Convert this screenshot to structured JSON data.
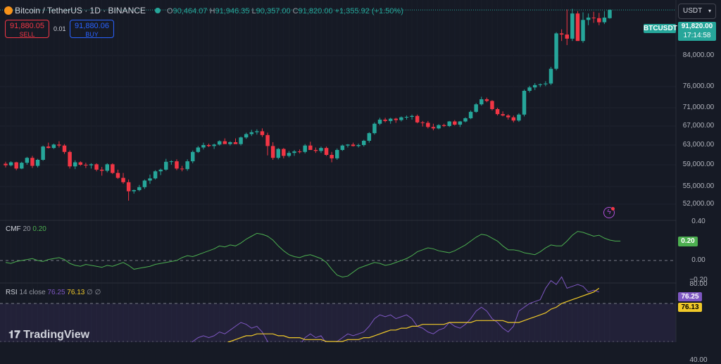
{
  "header": {
    "symbol": "Bitcoin / TetherUS · 1D · BINANCE",
    "o_label": "O",
    "o": "90,464.07",
    "h_label": "H",
    "h": "91,946.35",
    "l_label": "L",
    "l": "90,357.00",
    "c_label": "C",
    "c": "91,820.00",
    "change": "+1,355.92 (+1.50%)"
  },
  "trade": {
    "sell_price": "91,880.05",
    "sell_label": "SELL",
    "spread": "0.01",
    "buy_price": "91,880.06",
    "buy_label": "BUY"
  },
  "currency_select": "USDT",
  "price_badge": {
    "ticker": "BTCUSDT",
    "price": "91,820.00",
    "countdown": "17:14:58"
  },
  "cmf": {
    "label": "CMF",
    "period": "20",
    "value": "0.20",
    "badge": "0.20"
  },
  "rsi": {
    "label": "RSI",
    "params": "14 close",
    "value": "76.25",
    "ma": "76.13",
    "extra": "∅ ∅",
    "badge_rsi": "76.25",
    "badge_ma": "76.13"
  },
  "brand": "TradingView",
  "colors": {
    "up": "#26a69a",
    "down": "#f23645",
    "rsi": "#7e57c2",
    "rsi_ma": "#f0c929",
    "cmf": "#4caf50"
  },
  "chart_data": {
    "type": "candlestick",
    "y_ticks": [
      84000,
      76000,
      71000,
      67000,
      63000,
      59000,
      55000,
      52000
    ],
    "y_tick_labels": [
      "84,000.00",
      "76,000.00",
      "71,000.00",
      "67,000.00",
      "63,000.00",
      "59,000.00",
      "55,000.00",
      "52,000.00"
    ],
    "candles": [
      [
        59200,
        59600,
        58500,
        58900
      ],
      [
        58900,
        59700,
        58700,
        59500
      ],
      [
        59500,
        59600,
        58000,
        58300
      ],
      [
        58300,
        59600,
        58200,
        59400
      ],
      [
        59400,
        60600,
        59000,
        60400
      ],
      [
        60400,
        60800,
        58400,
        58800
      ],
      [
        58800,
        60200,
        58500,
        60000
      ],
      [
        60000,
        62900,
        59800,
        62700
      ],
      [
        62700,
        63500,
        62300,
        62400
      ],
      [
        62400,
        63300,
        62200,
        63100
      ],
      [
        63100,
        63800,
        62500,
        62900
      ],
      [
        62900,
        63200,
        61200,
        61600
      ],
      [
        61600,
        61900,
        58300,
        58700
      ],
      [
        58700,
        59900,
        58200,
        59500
      ],
      [
        59500,
        59700,
        58800,
        59000
      ],
      [
        59000,
        59400,
        58400,
        58900
      ],
      [
        58900,
        59300,
        58300,
        59100
      ],
      [
        59100,
        59300,
        57800,
        58100
      ],
      [
        58100,
        58600,
        57000,
        57900
      ],
      [
        57900,
        59300,
        57600,
        59100
      ],
      [
        59100,
        59300,
        57300,
        57500
      ],
      [
        57500,
        58100,
        56400,
        56600
      ],
      [
        56600,
        57500,
        55500,
        55800
      ],
      [
        55800,
        56300,
        52600,
        54200
      ],
      [
        54200,
        54500,
        53800,
        54400
      ],
      [
        54400,
        55300,
        54200,
        54900
      ],
      [
        54900,
        56300,
        54600,
        56100
      ],
      [
        56100,
        57200,
        55500,
        56500
      ],
      [
        56500,
        58000,
        56300,
        57800
      ],
      [
        57800,
        58300,
        57100,
        58100
      ],
      [
        58100,
        60200,
        57900,
        59600
      ],
      [
        59600,
        59900,
        59000,
        59700
      ],
      [
        59700,
        60100,
        58000,
        58300
      ],
      [
        58300,
        58800,
        57800,
        58200
      ],
      [
        58200,
        60100,
        57900,
        59700
      ],
      [
        59700,
        61900,
        59300,
        61600
      ],
      [
        61600,
        62800,
        61400,
        62500
      ],
      [
        62500,
        63500,
        62100,
        63000
      ],
      [
        63000,
        63300,
        62600,
        62800
      ],
      [
        62800,
        63300,
        62200,
        63100
      ],
      [
        63100,
        64000,
        62900,
        63800
      ],
      [
        63800,
        64400,
        63300,
        63200
      ],
      [
        63200,
        63800,
        62900,
        63600
      ],
      [
        63600,
        64400,
        63300,
        63200
      ],
      [
        63200,
        64800,
        62900,
        64600
      ],
      [
        64600,
        65600,
        64300,
        65300
      ],
      [
        65300,
        66200,
        64900,
        65700
      ],
      [
        65700,
        66300,
        65200,
        65900
      ],
      [
        65900,
        66500,
        64700,
        65100
      ],
      [
        65100,
        65600,
        60900,
        62800
      ],
      [
        62800,
        63600,
        60000,
        60400
      ],
      [
        60400,
        62400,
        60100,
        62200
      ],
      [
        62200,
        62400,
        60300,
        60800
      ],
      [
        60800,
        61800,
        60500,
        61400
      ],
      [
        61400,
        62000,
        60800,
        61700
      ],
      [
        61700,
        62100,
        61300,
        61600
      ],
      [
        61600,
        63200,
        61300,
        62900
      ],
      [
        62900,
        63700,
        62400,
        62000
      ],
      [
        62000,
        62500,
        61400,
        61800
      ],
      [
        61800,
        62700,
        61400,
        62400
      ],
      [
        62400,
        62700,
        60800,
        61000
      ],
      [
        61000,
        61600,
        59500,
        60300
      ],
      [
        60300,
        62300,
        60000,
        62000
      ],
      [
        62000,
        63100,
        61800,
        62900
      ],
      [
        62900,
        63200,
        62500,
        63100
      ],
      [
        63100,
        63500,
        62700,
        62800
      ],
      [
        62800,
        63300,
        62500,
        63000
      ],
      [
        63000,
        64100,
        62700,
        63900
      ],
      [
        63900,
        65700,
        63500,
        65500
      ],
      [
        65500,
        67800,
        65200,
        67500
      ],
      [
        67500,
        68800,
        67200,
        68400
      ],
      [
        68400,
        68800,
        67800,
        68100
      ],
      [
        68100,
        68800,
        67500,
        68600
      ],
      [
        68600,
        68800,
        67700,
        68300
      ],
      [
        68300,
        69100,
        68000,
        68900
      ],
      [
        68900,
        69300,
        68400,
        69000
      ],
      [
        69000,
        69500,
        68400,
        69200
      ],
      [
        69200,
        69500,
        67600,
        67800
      ],
      [
        67800,
        68100,
        66900,
        67700
      ],
      [
        67700,
        68100,
        66500,
        66800
      ],
      [
        66800,
        67500,
        66100,
        66500
      ],
      [
        66500,
        67400,
        66300,
        67200
      ],
      [
        67200,
        67500,
        66800,
        67000
      ],
      [
        67000,
        68100,
        66800,
        68000
      ],
      [
        68000,
        68300,
        67100,
        67300
      ],
      [
        67300,
        68100,
        66800,
        68000
      ],
      [
        68000,
        68900,
        67800,
        68700
      ],
      [
        68700,
        70400,
        68500,
        70100
      ],
      [
        70100,
        72100,
        69900,
        71800
      ],
      [
        71800,
        73600,
        71500,
        73000
      ],
      [
        73000,
        73400,
        72300,
        72600
      ],
      [
        72600,
        72800,
        70400,
        70700
      ],
      [
        70700,
        71000,
        69300,
        69600
      ],
      [
        69600,
        70200,
        69100,
        69300
      ],
      [
        69300,
        69600,
        68400,
        68900
      ],
      [
        68900,
        69300,
        67800,
        68200
      ],
      [
        68200,
        69800,
        67900,
        69500
      ],
      [
        69500,
        75300,
        69100,
        75000
      ],
      [
        75000,
        76200,
        74600,
        75800
      ],
      [
        75800,
        76900,
        75200,
        76400
      ],
      [
        76400,
        76800,
        75900,
        76600
      ],
      [
        76600,
        77400,
        76100,
        76800
      ],
      [
        76800,
        81100,
        76400,
        80600
      ],
      [
        80600,
        88000,
        80200,
        87800
      ],
      [
        87800,
        88500,
        86500,
        87600
      ],
      [
        87600,
        91900,
        85800,
        86900
      ],
      [
        86900,
        92000,
        86500,
        91200
      ],
      [
        91200,
        91600,
        86700,
        86500
      ],
      [
        86500,
        91400,
        86200,
        90100
      ],
      [
        90100,
        91200,
        89200,
        90500
      ],
      [
        90500,
        91500,
        89600,
        90400
      ],
      [
        90400,
        91300,
        89200,
        89700
      ],
      [
        89700,
        91600,
        89400,
        90500
      ],
      [
        90400,
        91900,
        90300,
        91800
      ]
    ],
    "cmf_ticks": [
      "0.40",
      "0.00",
      "−0.20"
    ],
    "cmf_values": [
      -0.02,
      -0.03,
      -0.01,
      0.0,
      0.01,
      0.02,
      0.0,
      -0.01,
      0.01,
      0.02,
      0.03,
      0.01,
      -0.03,
      -0.05,
      -0.06,
      -0.04,
      -0.05,
      -0.06,
      -0.07,
      -0.05,
      -0.06,
      -0.04,
      -0.02,
      -0.05,
      -0.09,
      -0.08,
      -0.07,
      -0.06,
      -0.04,
      -0.03,
      -0.02,
      -0.01,
      0.0,
      0.03,
      0.05,
      0.04,
      0.06,
      0.08,
      0.1,
      0.12,
      0.15,
      0.14,
      0.16,
      0.15,
      0.18,
      0.22,
      0.25,
      0.28,
      0.27,
      0.25,
      0.21,
      0.15,
      0.1,
      0.06,
      0.04,
      0.03,
      0.05,
      0.06,
      0.04,
      0.02,
      -0.02,
      -0.09,
      -0.15,
      -0.17,
      -0.16,
      -0.12,
      -0.08,
      -0.06,
      -0.04,
      -0.02,
      -0.03,
      -0.05,
      -0.04,
      -0.02,
      0.0,
      0.02,
      0.05,
      0.09,
      0.11,
      0.13,
      0.12,
      0.1,
      0.09,
      0.08,
      0.1,
      0.13,
      0.16,
      0.2,
      0.24,
      0.27,
      0.26,
      0.23,
      0.2,
      0.15,
      0.11,
      0.11,
      0.1,
      0.08,
      0.07,
      0.06,
      0.09,
      0.13,
      0.16,
      0.15,
      0.15,
      0.2,
      0.26,
      0.3,
      0.29,
      0.27,
      0.25,
      0.26,
      0.23,
      0.21,
      0.2,
      0.2
    ],
    "rsi_ticks": [
      "80.00",
      "40.00"
    ],
    "rsi_values": [
      38,
      35,
      34,
      37,
      39,
      38,
      36,
      42,
      44,
      45,
      44,
      40,
      35,
      33,
      34,
      33,
      35,
      34,
      36,
      35,
      34,
      32,
      33,
      31,
      34,
      36,
      38,
      40,
      42,
      43,
      45,
      46,
      44,
      43,
      47,
      50,
      52,
      53,
      52,
      53,
      55,
      54,
      56,
      58,
      60,
      59,
      57,
      58,
      55,
      50,
      45,
      47,
      46,
      48,
      49,
      48,
      52,
      54,
      52,
      53,
      49,
      46,
      50,
      52,
      54,
      53,
      54,
      55,
      58,
      62,
      64,
      63,
      64,
      62,
      63,
      64,
      62,
      58,
      57,
      55,
      54,
      56,
      57,
      60,
      58,
      57,
      59,
      62,
      66,
      68,
      66,
      62,
      60,
      57,
      55,
      58,
      66,
      68,
      70,
      71,
      72,
      78,
      82,
      80,
      84,
      78,
      79,
      80,
      79,
      76,
      77,
      76
    ],
    "rsi_ma_values": [
      40,
      40,
      39,
      39,
      39,
      38,
      38,
      38,
      38,
      38,
      39,
      39,
      39,
      38,
      38,
      38,
      38,
      38,
      38,
      39,
      39,
      39,
      40,
      40,
      40,
      40,
      40,
      41,
      41,
      41,
      42,
      42,
      43,
      44,
      44,
      45,
      46,
      46,
      47,
      48,
      49,
      49,
      50,
      51,
      52,
      53,
      53,
      54,
      54,
      54,
      54,
      53,
      53,
      52,
      52,
      52,
      51,
      51,
      51,
      51,
      50,
      50,
      50,
      50,
      51,
      51,
      51,
      52,
      52,
      53,
      54,
      55,
      56,
      56,
      57,
      57,
      58,
      58,
      59,
      59,
      59,
      59,
      59,
      60,
      60,
      60,
      60,
      60,
      61,
      61,
      61,
      61,
      61,
      61,
      60,
      60,
      60,
      61,
      62,
      63,
      64,
      65,
      67,
      68,
      70,
      71,
      72,
      73,
      74,
      75,
      76,
      78
    ]
  }
}
